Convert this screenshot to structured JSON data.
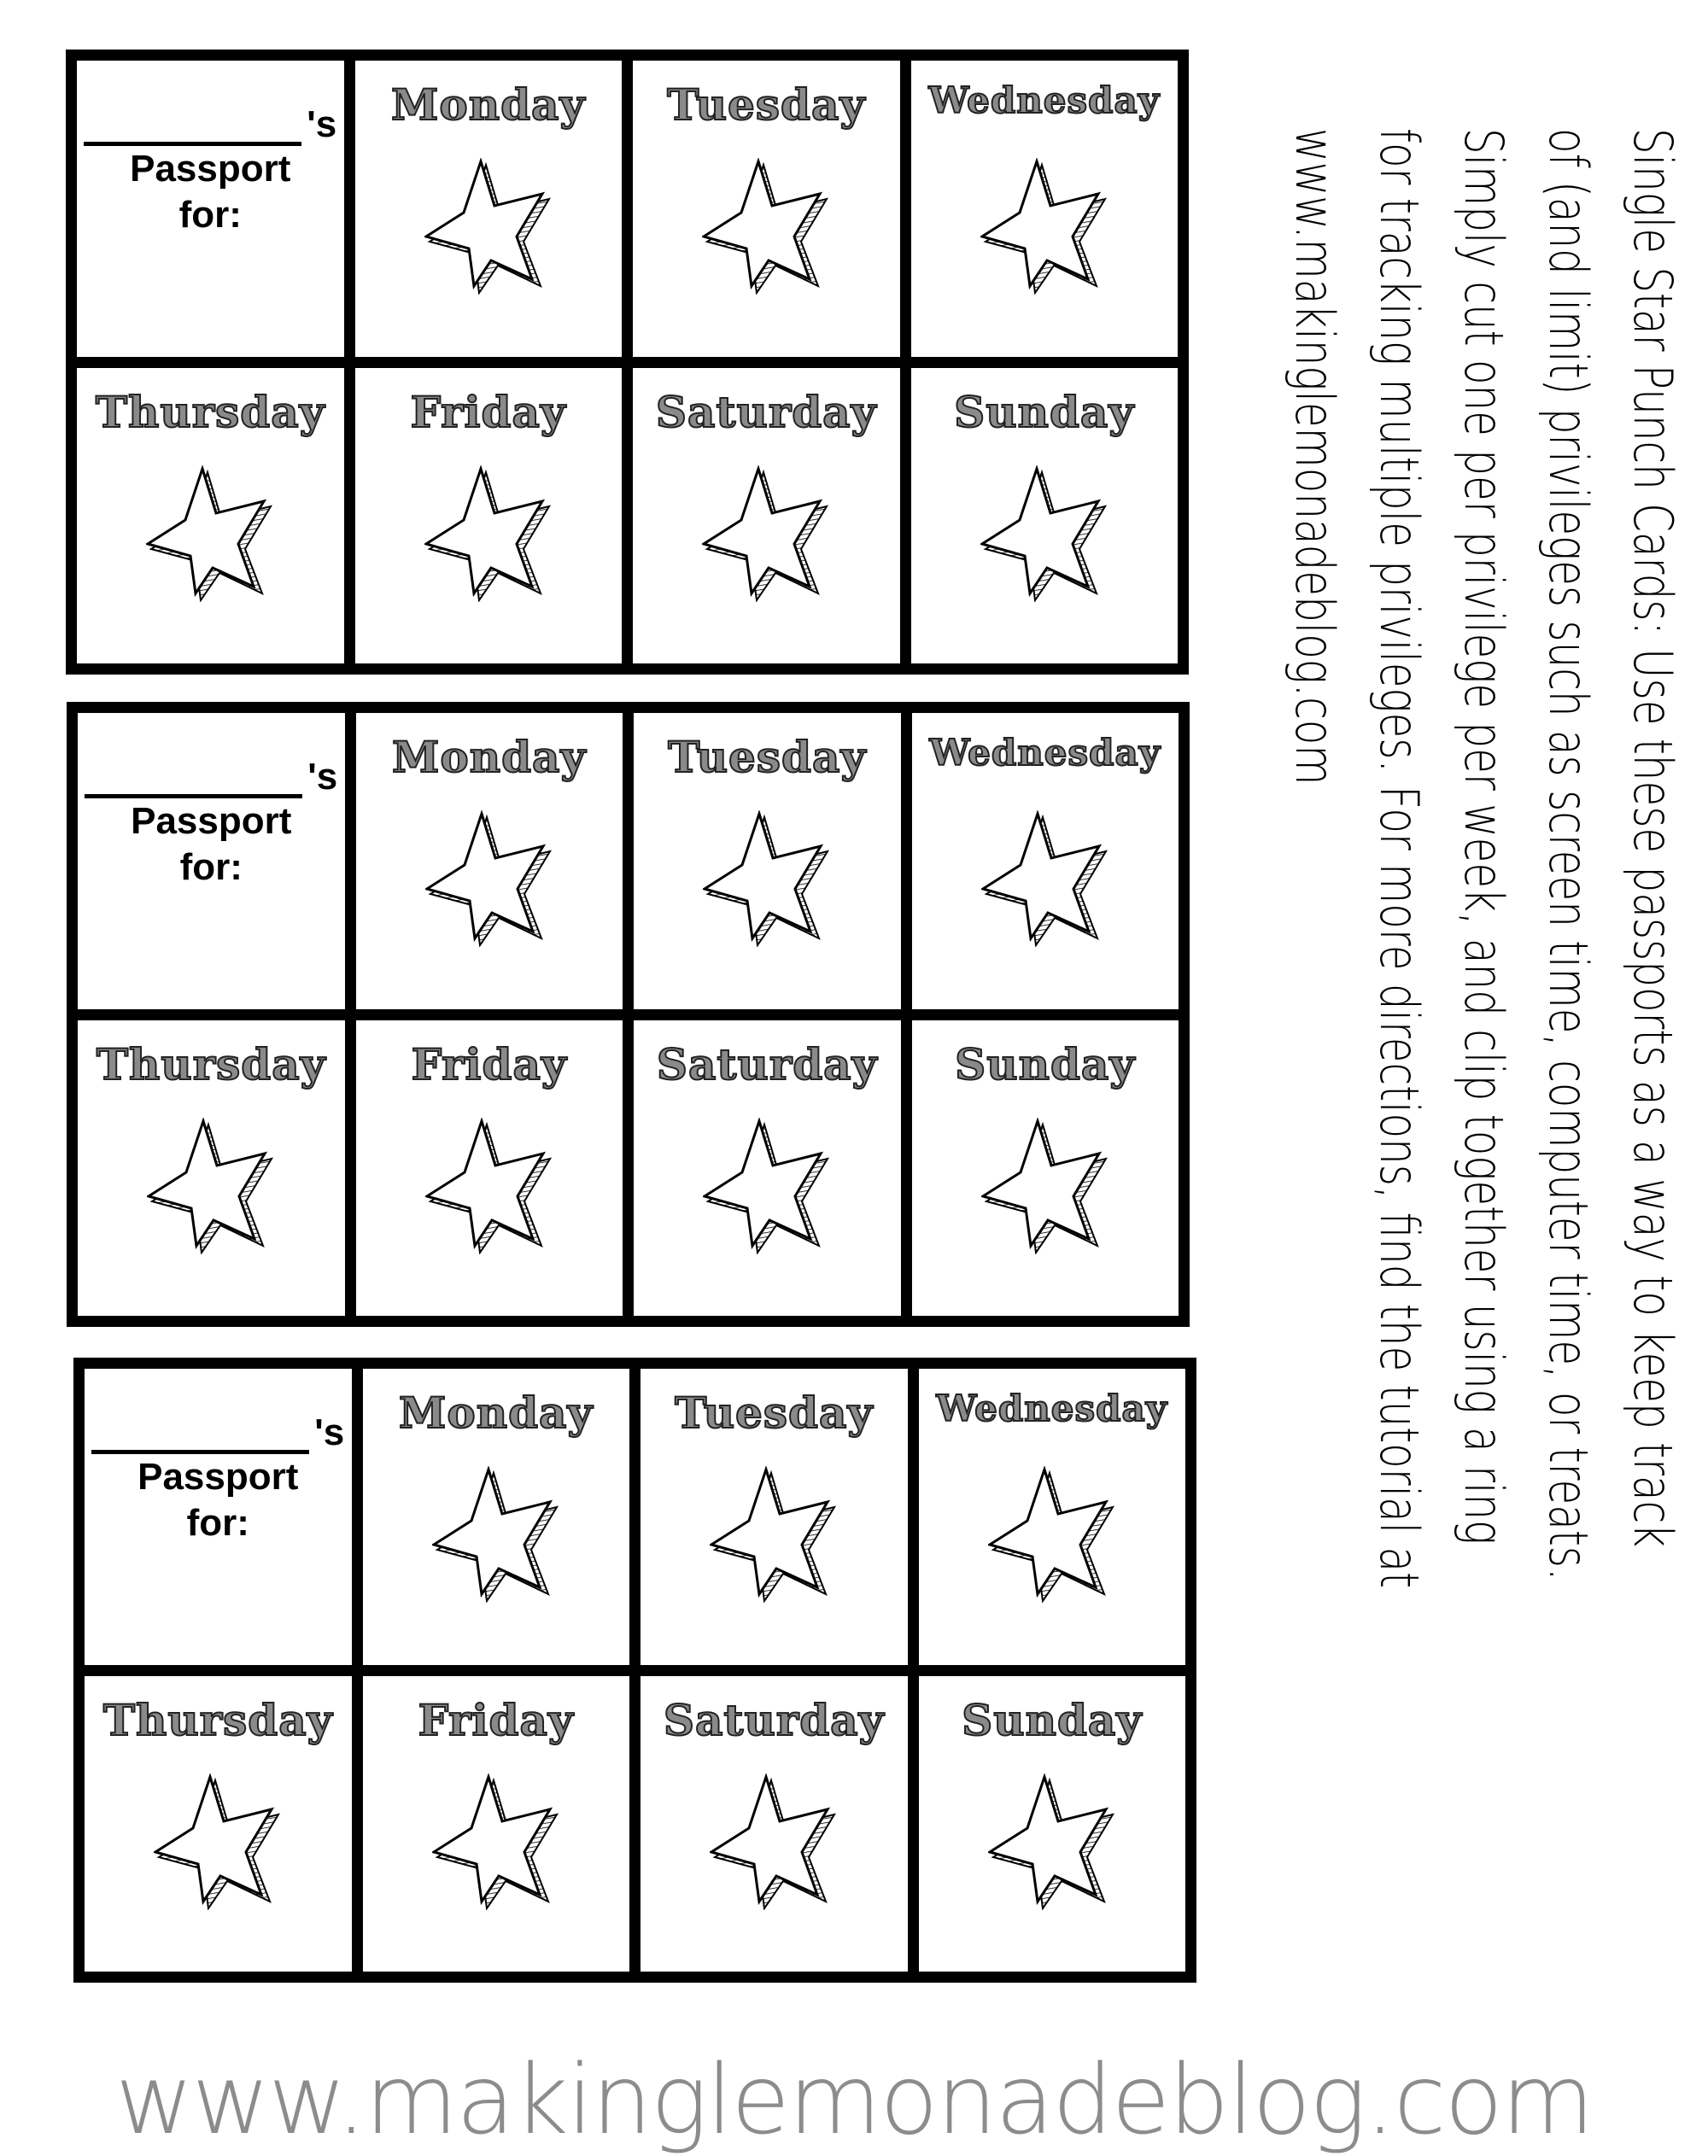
{
  "cards": [
    {
      "passport": {
        "possessive": "'s",
        "line1": "Passport",
        "line2": "for:"
      },
      "days": [
        "Monday",
        "Tuesday",
        "Wednesday",
        "Thursday",
        "Friday",
        "Saturday",
        "Sunday"
      ]
    },
    {
      "passport": {
        "possessive": "'s",
        "line1": "Passport",
        "line2": "for:"
      },
      "days": [
        "Monday",
        "Tuesday",
        "Wednesday",
        "Thursday",
        "Friday",
        "Saturday",
        "Sunday"
      ]
    },
    {
      "passport": {
        "possessive": "'s",
        "line1": "Passport",
        "line2": "for:"
      },
      "days": [
        "Monday",
        "Tuesday",
        "Wednesday",
        "Thursday",
        "Friday",
        "Saturday",
        "Sunday"
      ]
    }
  ],
  "instructions": [
    "Single Star Punch Cards:  Use these passports as a way to keep track",
    "of (and limit) privileges such as screen time, computer time, or treats.",
    "Simply cut one per privilege per week, and clip together using a ring",
    "for tracking multiple privileges.  For more directions, find the tutorial at",
    "www.makinglemonadeblog.com"
  ],
  "footer": "www.makinglemonadeblog.com",
  "icons": {
    "day_star": "star-icon"
  }
}
